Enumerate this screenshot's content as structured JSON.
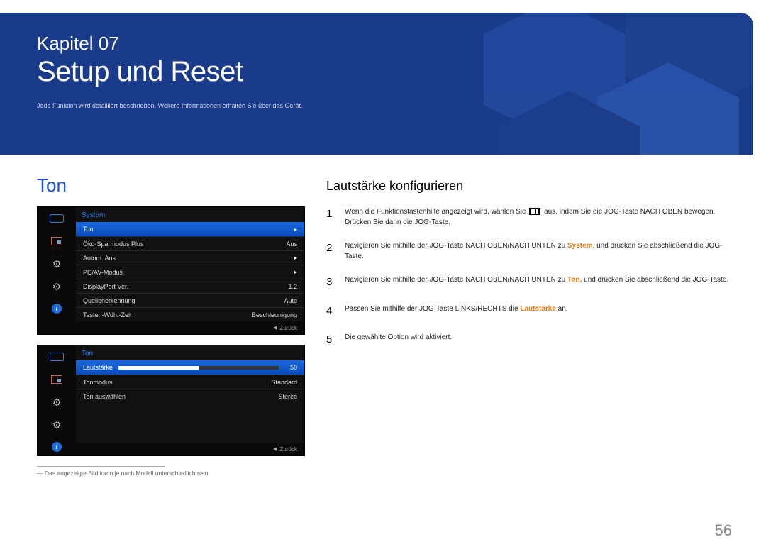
{
  "chapter": {
    "label": "Kapitel 07",
    "title": "Setup und Reset",
    "description": "Jede Funktion wird detailliert beschrieben. Weitere Informationen erhalten Sie über das Gerät."
  },
  "left": {
    "section_title": "Ton",
    "osd1": {
      "header": "System",
      "rows": [
        {
          "label": "Ton",
          "value": "▸",
          "selected": true
        },
        {
          "label": "Öko-Sparmodus Plus",
          "value": "Aus"
        },
        {
          "label": "Autom. Aus",
          "value": "▸"
        },
        {
          "label": "PC/AV-Modus",
          "value": "▸"
        },
        {
          "label": "DisplayPort Ver.",
          "value": "1.2"
        },
        {
          "label": "Quellenerkennung",
          "value": "Auto"
        },
        {
          "label": "Tasten-Wdh.-Zeit",
          "value": "Beschleunigung"
        }
      ],
      "back": "Zurück"
    },
    "osd2": {
      "header": "Ton",
      "rows": [
        {
          "label": "Lautstärke",
          "value": "50",
          "selected": true,
          "slider": true
        },
        {
          "label": "Tonmodus",
          "value": "Standard"
        },
        {
          "label": "Ton auswählen",
          "value": "Stereo"
        }
      ],
      "back": "Zurück"
    },
    "footnote_marker": "―",
    "footnote": "Das angezeigte Bild kann je nach Modell unterschiedlich sein."
  },
  "right": {
    "title": "Lautstärke konfigurieren",
    "steps": [
      {
        "num": "1",
        "parts": [
          {
            "t": "Wenn die Funktionstastenhilfe angezeigt wird, wählen Sie "
          },
          {
            "icon": true
          },
          {
            "t": " aus, indem Sie die JOG-Taste NACH OBEN bewegen."
          },
          {
            "br": true
          },
          {
            "t": "Drücken Sie dann die JOG-Taste."
          }
        ]
      },
      {
        "num": "2",
        "parts": [
          {
            "t": "Navigieren Sie mithilfe der JOG-Taste NACH OBEN/NACH UNTEN zu "
          },
          {
            "t": "System",
            "cls": "hl-orange"
          },
          {
            "t": ", und drücken Sie abschließend die JOG-Taste."
          }
        ]
      },
      {
        "num": "3",
        "parts": [
          {
            "t": "Navigieren Sie mithilfe der JOG-Taste NACH OBEN/NACH UNTEN zu "
          },
          {
            "t": "Ton",
            "cls": "hl-orange"
          },
          {
            "t": ", und drücken Sie abschließend die JOG-Taste."
          }
        ]
      },
      {
        "num": "4",
        "parts": [
          {
            "t": "Passen Sie mithilfe der JOG-Taste LINKS/RECHTS die "
          },
          {
            "t": "Lautstärke",
            "cls": "hl-orange"
          },
          {
            "t": " an."
          }
        ]
      },
      {
        "num": "5",
        "parts": [
          {
            "t": "Die gewählte Option wird aktiviert."
          }
        ]
      }
    ]
  },
  "page_number": "56"
}
